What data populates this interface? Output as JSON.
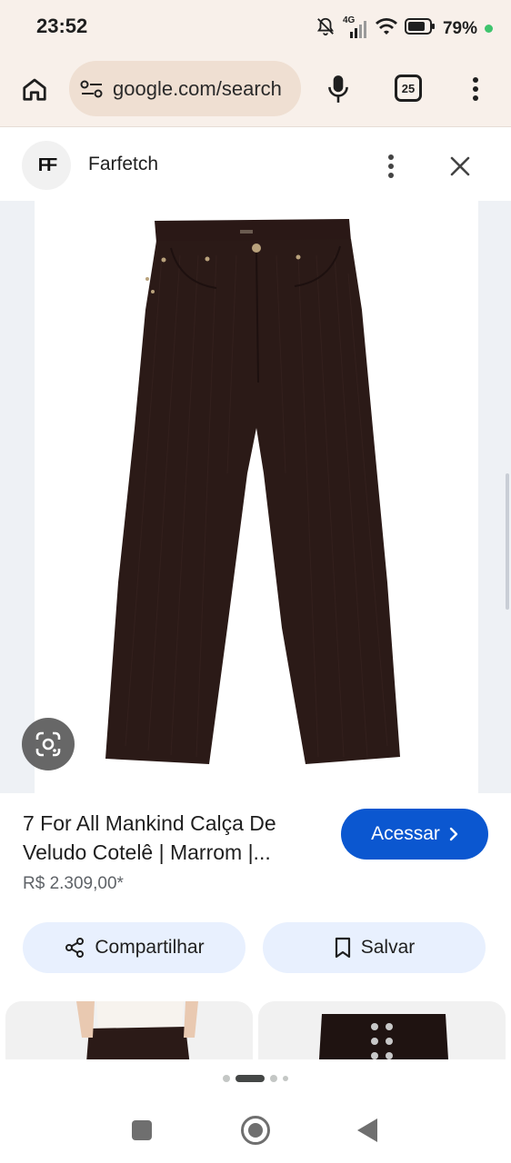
{
  "status_bar": {
    "time": "23:52",
    "network": "4G",
    "battery": "79%",
    "icons": [
      "bell-off-icon",
      "signal-icon",
      "wifi-icon",
      "battery-icon"
    ]
  },
  "browser": {
    "url": "google.com/search",
    "tab_count": "25",
    "icons": [
      "home-icon",
      "site-settings-icon",
      "mic-icon",
      "tabs-icon",
      "more-vert-icon"
    ]
  },
  "source": {
    "logo_text": "FF",
    "name": "Farfetch"
  },
  "product": {
    "title_line1": "7 For All Mankind Calça De",
    "title_line2": "Veludo Cotelê | Marrom |...",
    "price": "R$ 2.309,00*",
    "visit_label": "Acessar",
    "share_label": "Compartilhar",
    "save_label": "Salvar",
    "image_desc_color": "#2b1a17"
  },
  "colors": {
    "accent": "#0b57d0",
    "chip_bg": "#e8f0fe",
    "browser_bar": "#f8f0ea"
  },
  "pager": {
    "active_index": 1,
    "total": 4
  }
}
